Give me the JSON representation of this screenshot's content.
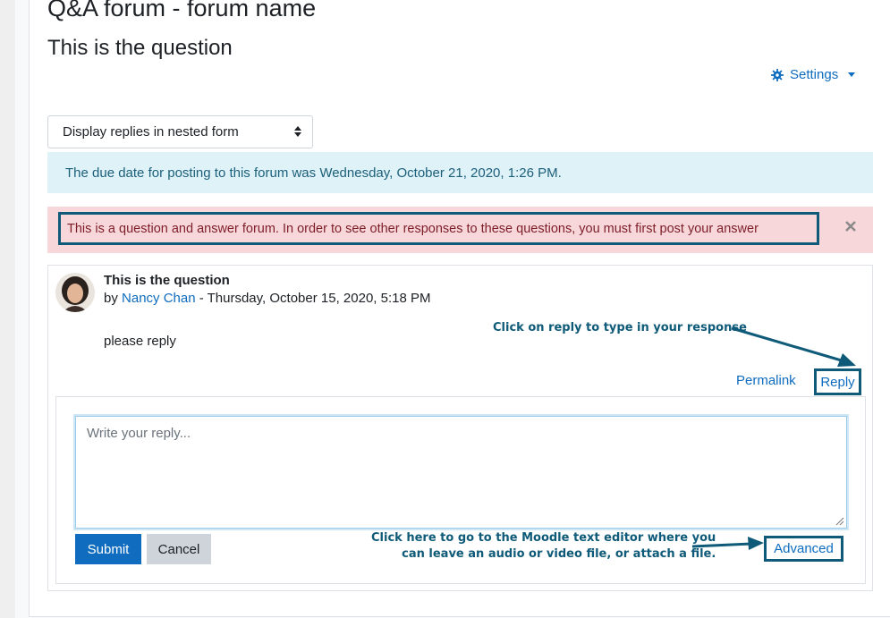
{
  "header": {
    "forum_title": "Q&A forum - forum name",
    "question_title": "This is the question"
  },
  "settings": {
    "label": "Settings",
    "icon": "gear-icon"
  },
  "display_mode": {
    "selected": "Display replies in nested form"
  },
  "alerts": {
    "info": "The due date for posting to this forum was Wednesday, October 21, 2020, 1:26 PM.",
    "danger": "This is a question and answer forum. In order to see other responses to these questions, you must first post your answer"
  },
  "post": {
    "subject": "This is the question",
    "by_prefix": "by",
    "author": "Nancy Chan",
    "date": " - Thursday, October 15, 2020, 5:18 PM",
    "message": "please reply",
    "permalink_label": "Permalink",
    "reply_label": "Reply"
  },
  "reply_form": {
    "placeholder": "Write your reply...",
    "submit_label": "Submit",
    "cancel_label": "Cancel",
    "advanced_label": "Advanced"
  },
  "annotations": {
    "reply_hint": "Click on reply to type in your response",
    "advanced_hint_line1": "Click here to go to the Moodle text editor where you",
    "advanced_hint_line2": "can leave an audio or video file, or attach a file."
  },
  "colors": {
    "link": "#0f6cbf",
    "annotation": "#0e5a78",
    "info_bg": "#def2f8",
    "danger_bg": "#f8d7da"
  }
}
